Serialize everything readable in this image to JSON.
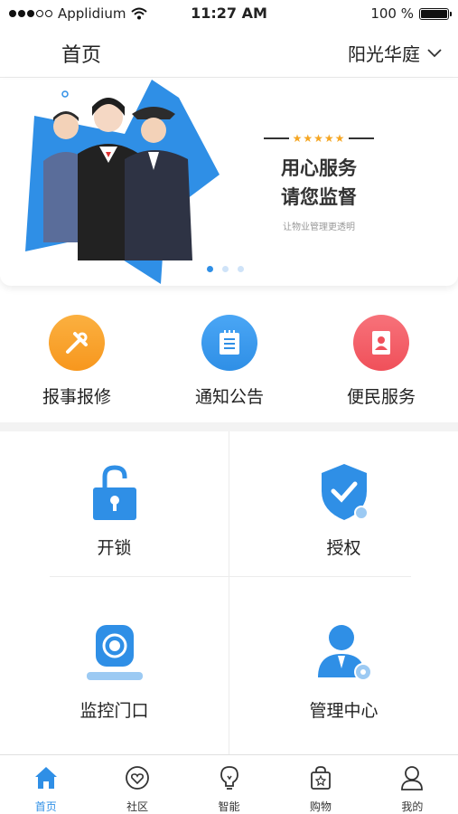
{
  "status_bar": {
    "carrier": "Applidium",
    "time": "11:27 AM",
    "battery": "100 %"
  },
  "header": {
    "title": "首页",
    "community": "阳光华庭"
  },
  "banner": {
    "headline_line1": "用心服务",
    "headline_line2": "请您监督",
    "subtitle": "让物业管理更透明",
    "stars": "★★★★★",
    "pages": 3,
    "active_page": 1
  },
  "quick_services": [
    {
      "label": "报事报修",
      "icon": "tools-icon",
      "color": "#f7971e"
    },
    {
      "label": "通知公告",
      "icon": "notice-icon",
      "color": "#2f8fe6"
    },
    {
      "label": "便民服务",
      "icon": "contacts-icon",
      "color": "#f0505a"
    }
  ],
  "grid": [
    {
      "label": "开锁",
      "icon": "unlock-icon"
    },
    {
      "label": "授权",
      "icon": "authorize-shield-icon"
    },
    {
      "label": "监控门口",
      "icon": "camera-icon"
    },
    {
      "label": "管理中心",
      "icon": "manager-icon"
    }
  ],
  "tabs": [
    {
      "label": "首页",
      "icon": "home-icon",
      "active": true
    },
    {
      "label": "社区",
      "icon": "community-heart-icon",
      "active": false
    },
    {
      "label": "智能",
      "icon": "bulb-icon",
      "active": false
    },
    {
      "label": "购物",
      "icon": "shopping-bag-icon",
      "active": false
    },
    {
      "label": "我的",
      "icon": "profile-icon",
      "active": false
    }
  ],
  "colors": {
    "accent": "#2f8fe6",
    "star": "#f5a623"
  }
}
